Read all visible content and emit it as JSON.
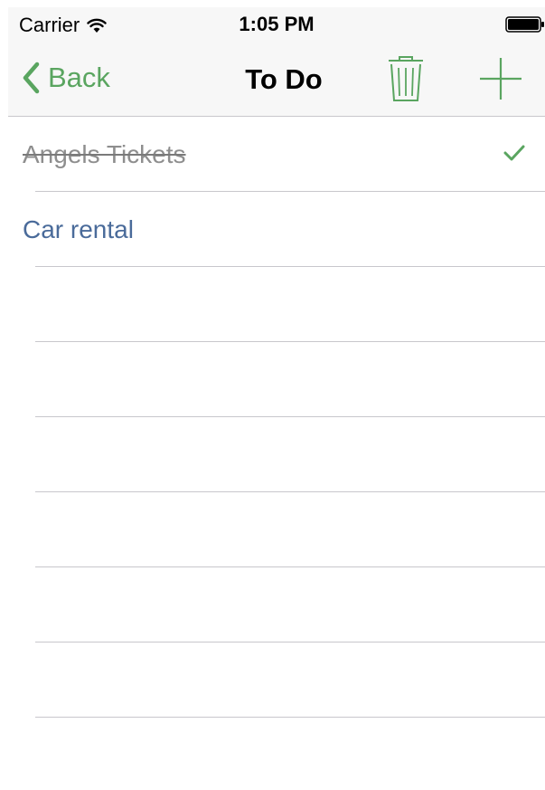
{
  "status_bar": {
    "carrier": "Carrier",
    "time": "1:05 PM",
    "wifi_icon": "wifi-icon",
    "battery_icon": "battery-icon"
  },
  "nav": {
    "back_label": "Back",
    "title": "To Do",
    "trash_icon": "trash-icon",
    "add_icon": "plus-icon",
    "accent_color": "#5aa560"
  },
  "todos": [
    {
      "label": "Angels Tickets",
      "completed": true
    },
    {
      "label": "Car rental",
      "completed": false
    }
  ],
  "colors": {
    "completed_text": "#8e8e8e",
    "pending_text": "#4a6b9a",
    "checkmark": "#5aa560"
  }
}
